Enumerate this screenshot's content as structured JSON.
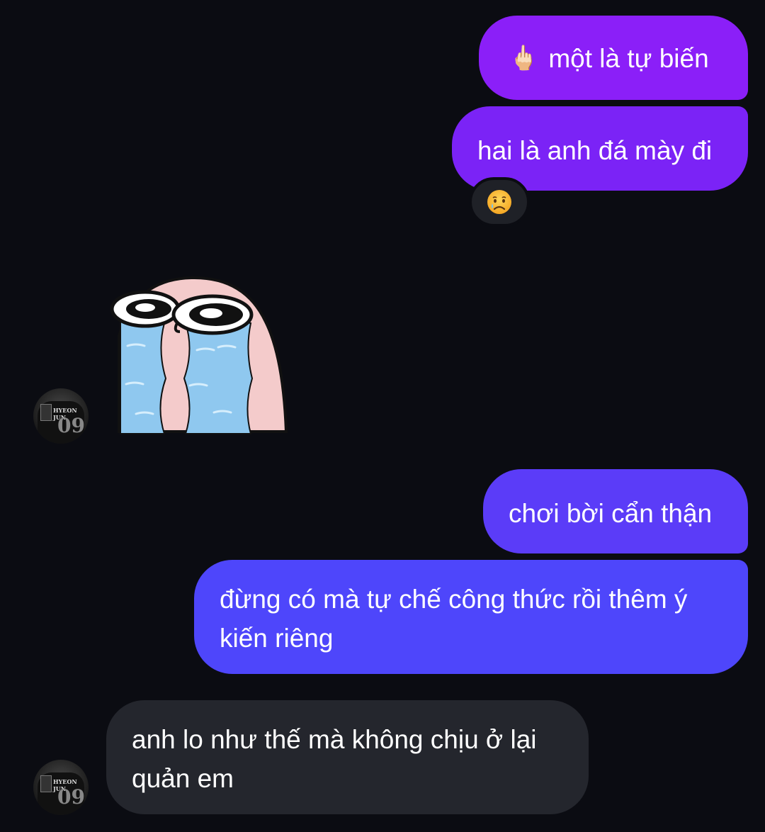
{
  "messages": {
    "sent_1": {
      "emoji": "🖕🏻",
      "text": "một là tự biến"
    },
    "sent_2": {
      "text": "hai là anh đá mày đi",
      "reaction": "😢"
    },
    "received_sticker": {
      "sticker": "crying-blob-sticker"
    },
    "sent_3": {
      "text": "chơi bời cẩn thận"
    },
    "sent_4": {
      "text": "đừng có mà tự chế công thức rồi thêm ý kiến riêng"
    },
    "received_1": {
      "text": "anh lo như thế mà không chịu ở lại quản em"
    }
  },
  "avatar": {
    "name": "HYEON JUN",
    "number": "09"
  },
  "colors": {
    "background": "#0b0c12",
    "sent_1": "#8b1ff8",
    "sent_2": "#7b23f6",
    "sent_3": "#5b3cf8",
    "sent_4": "#4e46fb",
    "received": "#24262d"
  }
}
